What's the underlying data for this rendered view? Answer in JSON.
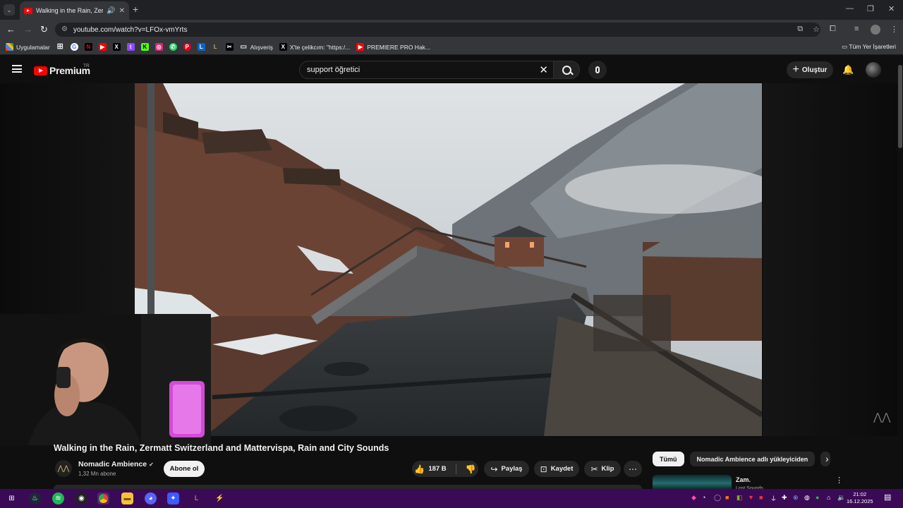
{
  "browser": {
    "tab_title": "Walking in the Rain, Zermatt",
    "url": "youtube.com/watch?v=LFOx-vmYrts",
    "bookmarks": [
      {
        "label": "Uygulamalar"
      },
      {
        "label": "Alışveriş"
      },
      {
        "label": "X'te çelikcım: \"https:/..."
      },
      {
        "label": "PREMIERE PRO Hak..."
      }
    ],
    "all_bookmarks": "Tüm Yer İşaretleri"
  },
  "youtube": {
    "logo_text": "Premium",
    "logo_country": "TR",
    "search_value": "support öğretici",
    "create_label": "Oluştur",
    "video": {
      "title": "Walking in the Rain, Zermatt Switzerland and Mattervispa, Rain and City Sounds",
      "channel_name": "Nomadic Ambience",
      "subscribers": "1,32 Mn abone",
      "subscribe_label": "Abone ol",
      "likes": "187 B",
      "share_label": "Paylaş",
      "save_label": "Kaydet",
      "clip_label": "Klip"
    },
    "chips": [
      "Tümü",
      "Nomadic Ambience adlı yükleyiciden"
    ],
    "recommendation": {
      "title": "Zam.",
      "subtitle": "Lost Sounds"
    }
  },
  "taskbar": {
    "time": "21:02",
    "date": "16.12.2025"
  },
  "colors": {
    "youtube_red": "#ff0000",
    "taskbar_purple": "#3b0a57",
    "yt_background": "#0f0f0f"
  }
}
